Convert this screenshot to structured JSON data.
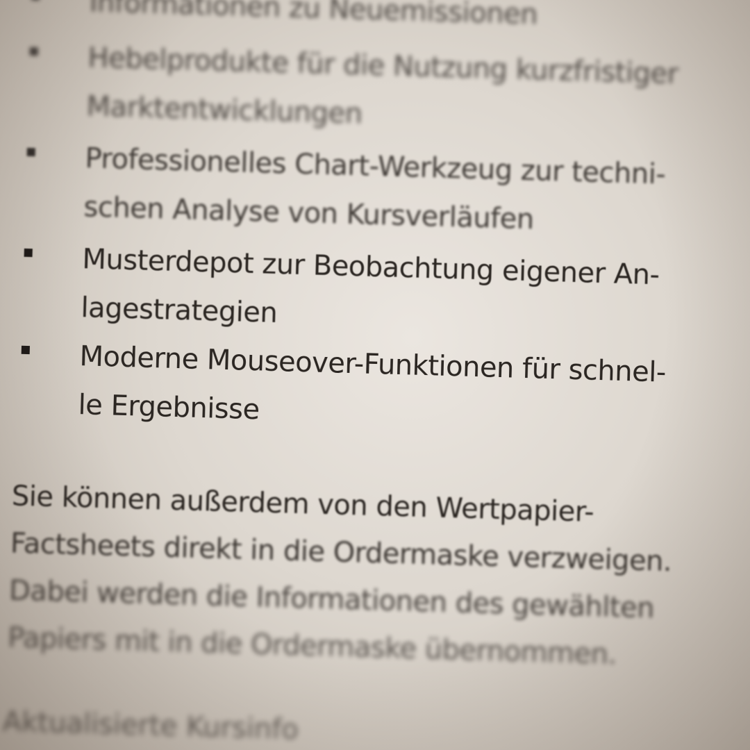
{
  "bullets": [
    {
      "lines": [
        "Informationen zu Neuemissionen"
      ]
    },
    {
      "lines": [
        "Hebelprodukte für die Nutzung kurzfristiger",
        "Marktentwicklungen"
      ]
    },
    {
      "lines": [
        "Professionelles Chart-Werkzeug zur techni-",
        "schen Analyse von Kursverläufen"
      ]
    },
    {
      "lines": [
        "Musterdepot zur Beobachtung eigener An-",
        "lagestrategien"
      ]
    },
    {
      "lines": [
        "Moderne Mouseover-Funktionen für schnel-",
        "le Ergebnisse"
      ]
    }
  ],
  "paragraph": {
    "lines": [
      "Sie können außerdem von den Wertpapier-",
      "Factsheets direkt in die Ordermaske verzweigen.",
      "Dabei werden die Informationen des gewählten",
      "Papiers mit in die Ordermaske übernommen."
    ]
  },
  "footer": {
    "line": "Aktualisierte Kursinfo"
  }
}
